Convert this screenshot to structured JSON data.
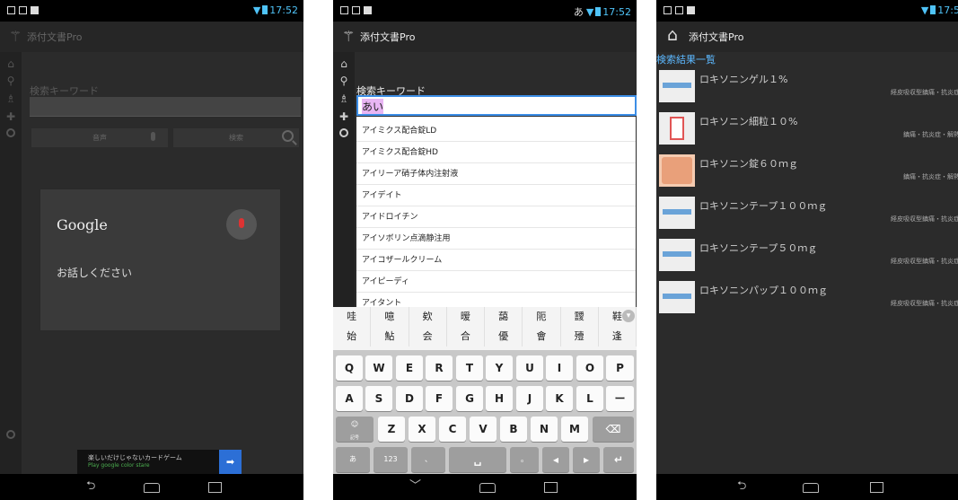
{
  "status": {
    "time": "17:52",
    "time_partial": "17:5",
    "ime_indicator": "あ"
  },
  "app": {
    "title": "添付文書Pro"
  },
  "search": {
    "label": "検索キーワード",
    "voice_button": "音声",
    "search_button": "検索",
    "typed_text": "あい"
  },
  "voice": {
    "logo": "Google",
    "prompt": "お話しください"
  },
  "ad": {
    "text": "楽しいだけじゃないカードゲーム",
    "sub": "Play google color stare"
  },
  "suggestions": [
    "アイミクス配合錠LD",
    "アイミクス配合錠HD",
    "アイリーア硝子体内注射液",
    "アイデイト",
    "アイドロイチン",
    "アイソボリン点滴静注用",
    "アイコザールクリーム",
    "アイピーディ",
    "アイタント"
  ],
  "ime": {
    "candidates_row1": [
      "哇",
      "噫",
      "欸",
      "暧",
      "藹",
      "阨",
      "靉",
      "鞋"
    ],
    "candidates_row1_sub": [
      "",
      "",
      "",
      "",
      "",
      "",
      "",
      ""
    ],
    "candidates_row2": [
      "始",
      "鮎",
      "会",
      "合",
      "優",
      "會",
      "",
      "殪",
      "逢"
    ],
    "candidates_row2_sub": [
      "",
      "",
      "",
      "",
      "",
      "",
      "",
      "",
      ""
    ]
  },
  "keyboard": {
    "row1": [
      "Q",
      "W",
      "E",
      "R",
      "T",
      "Y",
      "U",
      "I",
      "O",
      "P"
    ],
    "row2": [
      "A",
      "S",
      "D",
      "F",
      "G",
      "H",
      "J",
      "K",
      "L",
      "ー"
    ],
    "row3": [
      "Z",
      "X",
      "C",
      "V",
      "B",
      "N",
      "M"
    ],
    "emoji_sub": "記号",
    "kana_key": "あ",
    "num_key": "123",
    "comma_key": "、",
    "period_key": "。"
  },
  "results": {
    "header": "検索結果一覧",
    "items": [
      {
        "name": "ロキソニンゲル１%",
        "category": "経皮吸収型鎮痛・抗炎症"
      },
      {
        "name": "ロキソニン細粒１０%",
        "category": "鎮痛・抗炎症・解熱"
      },
      {
        "name": "ロキソニン錠６０ｍｇ",
        "category": "鎮痛・抗炎症・解熱"
      },
      {
        "name": "ロキソニンテープ１００ｍｇ",
        "category": "経皮吸収型鎮痛・抗炎症"
      },
      {
        "name": "ロキソニンテープ５０ｍｇ",
        "category": "経皮吸収型鎮痛・抗炎症"
      },
      {
        "name": "ロキソニンパップ１００ｍｇ",
        "category": "経皮吸収型鎮痛・抗炎症"
      }
    ]
  }
}
